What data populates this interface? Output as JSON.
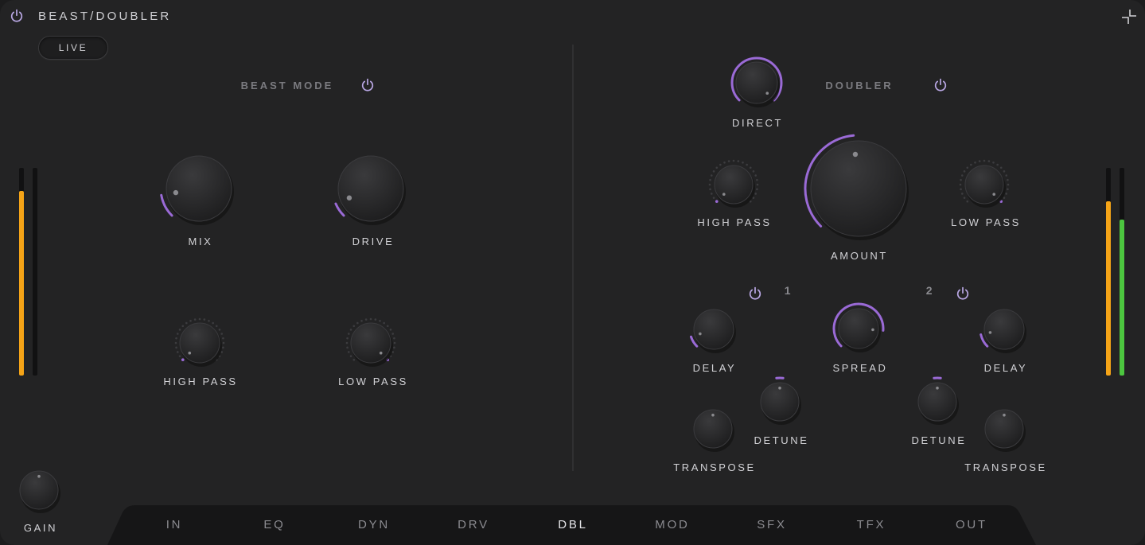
{
  "header": {
    "title": "BEAST/DOUBLER",
    "live_label": "LIVE"
  },
  "colors": {
    "accent": "#9a6ad6",
    "meter_orange": "#f5a417",
    "meter_green": "#4cc63f",
    "background": "#232324",
    "tab_bar": "#141415"
  },
  "icons": [
    "power-icon",
    "collapse-icon"
  ],
  "beast": {
    "title": "BEAST MODE",
    "enabled": true,
    "knobs": {
      "mix": {
        "label": "MIX",
        "value": 0.13
      },
      "drive": {
        "label": "DRIVE",
        "value": 0.08
      },
      "high_pass": {
        "label": "HIGH PASS",
        "value": 0.0
      },
      "low_pass": {
        "label": "LOW PASS",
        "value": 1.0
      }
    }
  },
  "doubler": {
    "title": "DOUBLER",
    "enabled": true,
    "knobs": {
      "direct": {
        "label": "DIRECT",
        "value": 1.0
      },
      "amount": {
        "label": "AMOUNT",
        "value": 0.48
      },
      "high_pass": {
        "label": "HIGH PASS",
        "value": 0.0
      },
      "low_pass": {
        "label": "LOW PASS",
        "value": 1.0
      },
      "spread": {
        "label": "SPREAD",
        "value": 0.85
      }
    },
    "voices": [
      {
        "number": "1",
        "enabled": true,
        "delay": {
          "label": "DELAY",
          "value": 0.1
        },
        "detune": {
          "label": "DETUNE",
          "value": 0.5
        },
        "transpose": {
          "label": "TRANSPOSE",
          "value": 0.5
        }
      },
      {
        "number": "2",
        "enabled": true,
        "delay": {
          "label": "DELAY",
          "value": 0.12
        },
        "detune": {
          "label": "DETUNE",
          "value": 0.5
        },
        "transpose": {
          "label": "TRANSPOSE",
          "value": 0.5
        }
      }
    ]
  },
  "gain": {
    "label": "GAIN",
    "value": 0.5
  },
  "meters": {
    "input": [
      0.89,
      0.0
    ],
    "output": [
      0.84,
      0.75
    ]
  },
  "tabs": [
    {
      "label": "IN",
      "active": false
    },
    {
      "label": "EQ",
      "active": false
    },
    {
      "label": "DYN",
      "active": false
    },
    {
      "label": "DRV",
      "active": false
    },
    {
      "label": "DBL",
      "active": true
    },
    {
      "label": "MOD",
      "active": false
    },
    {
      "label": "SFX",
      "active": false
    },
    {
      "label": "TFX",
      "active": false
    },
    {
      "label": "OUT",
      "active": false
    }
  ]
}
